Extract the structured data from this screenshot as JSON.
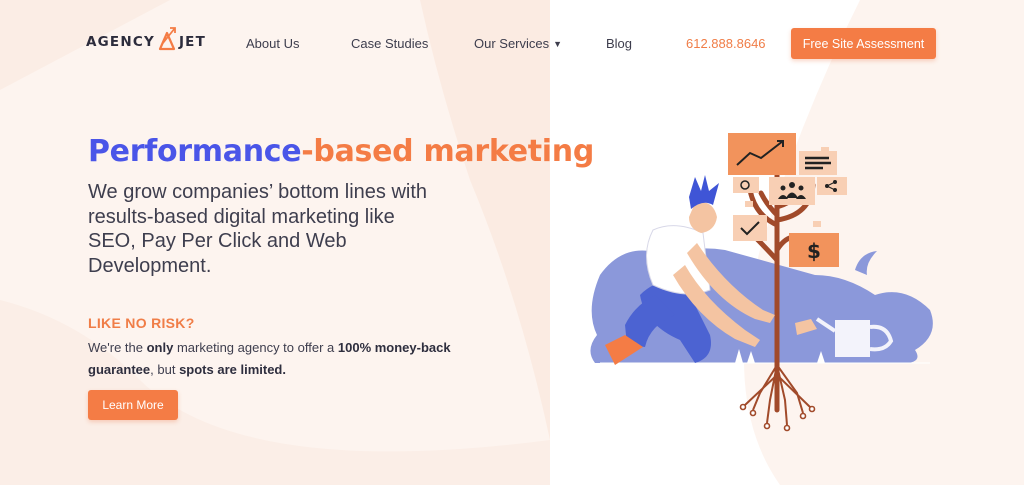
{
  "brand": {
    "logo_left": "AGENCY",
    "logo_right": "JET",
    "accent_color": "#f47c45",
    "primary_color": "#4a55e8"
  },
  "nav": {
    "items": [
      {
        "label": "About Us"
      },
      {
        "label": "Case Studies"
      },
      {
        "label": "Our Services"
      },
      {
        "label": "Blog"
      }
    ],
    "phone": "612.888.8646",
    "cta_label": "Free Site Assessment"
  },
  "hero": {
    "title_part1": "Performance",
    "title_part2": "-based marketing",
    "subtitle": "We grow companies’ bottom lines with results-based digital marketing like SEO, Pay Per Click and Web Development.",
    "risk_heading": "LIKE NO RISK?",
    "risk_t1": "We're the ",
    "risk_b1": "only",
    "risk_t2": " marketing agency to offer a ",
    "risk_b2": "100% money-back guarantee",
    "risk_t3": ", but ",
    "risk_b3": "spots are limited.",
    "learn_more_label": "Learn More"
  },
  "illustration": {
    "icons": [
      "chart-up-icon",
      "smiley-icon",
      "team-icon",
      "share-icon",
      "checkmark-icon",
      "dollar-icon",
      "document-icon"
    ],
    "dollar_symbol": "$"
  }
}
